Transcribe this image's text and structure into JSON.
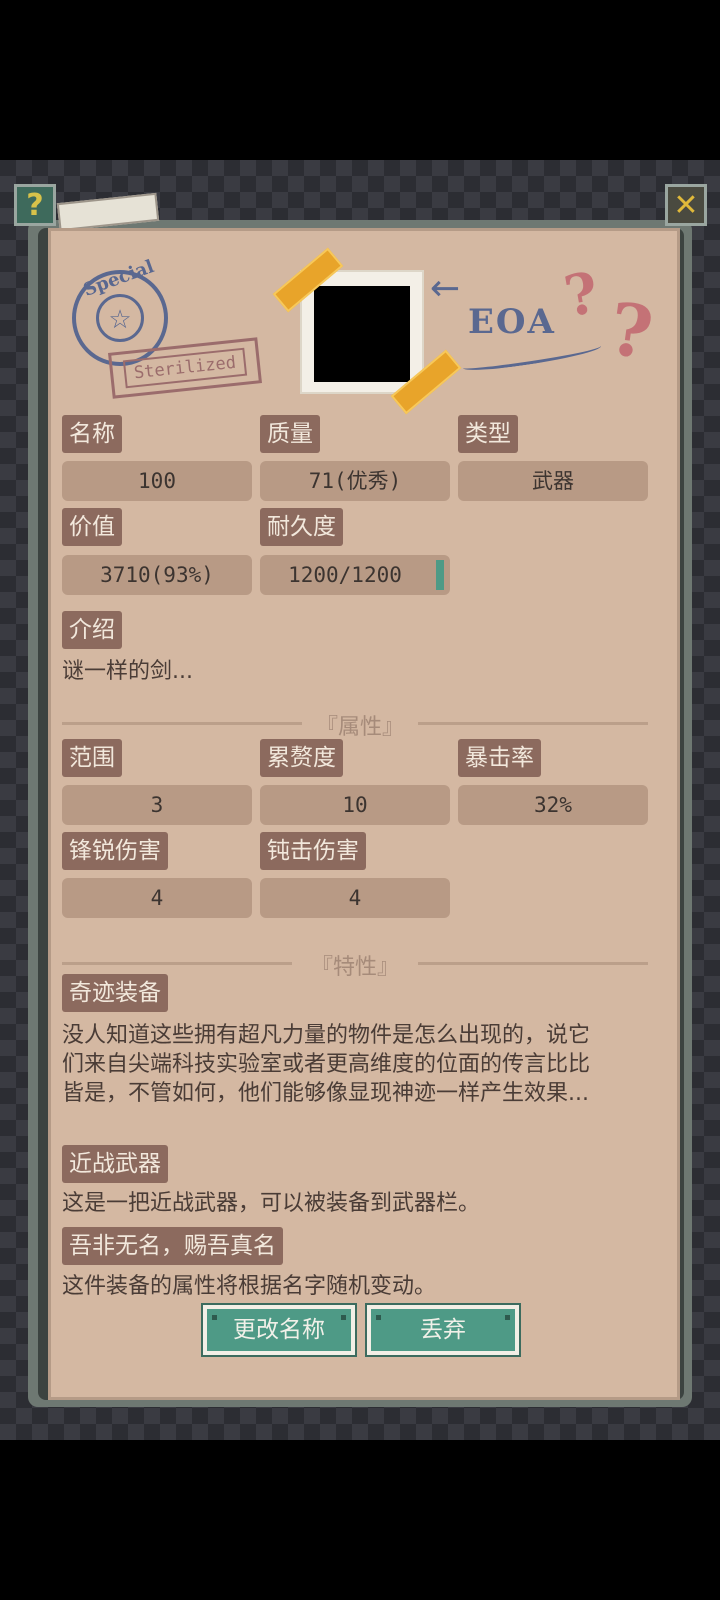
{
  "header": {
    "help_icon": "question-icon",
    "close_icon": "close-x-icon"
  },
  "decor": {
    "stamp_text": "Special",
    "steril_text": "Sterilized",
    "eoa_text": "EOA",
    "arrow": "←",
    "question_marks": [
      "?",
      "?"
    ]
  },
  "stats": {
    "name_label": "名称",
    "name_value": "100",
    "quality_label": "质量",
    "quality_value": "71(优秀)",
    "type_label": "类型",
    "type_value": "武器",
    "price_label": "价值",
    "price_value": "3710(93%)",
    "durability_label": "耐久度",
    "durability_value": "1200/1200",
    "durability_fraction": 1.0
  },
  "intro": {
    "label": "介绍",
    "text": "谜一样的剑..."
  },
  "attributes": {
    "title": "『属性』",
    "range_label": "范围",
    "range_value": "3",
    "burden_label": "累赘度",
    "burden_value": "10",
    "crit_label": "暴击率",
    "crit_value": "32%",
    "sharp_label": "锋锐伤害",
    "sharp_value": "4",
    "blunt_label": "钝击伤害",
    "blunt_value": "4"
  },
  "traits": {
    "title": "『特性』",
    "items": [
      {
        "label": "奇迹装备",
        "lines": [
          "没人知道这些拥有超凡力量的物件是怎么出现的，说它",
          "们来自尖端科技实验室或者更高维度的位面的传言比比",
          "皆是，不管如何，他们能够像显现神迹一样产生效果..."
        ]
      },
      {
        "label": "近战武器",
        "lines": [
          "这是一把近战武器，可以被装备到武器栏。"
        ]
      },
      {
        "label": "吾非无名，赐吾真名",
        "lines": [
          "这件装备的属性将根据名字随机变动。"
        ]
      }
    ]
  },
  "actions": {
    "rename": "更改名称",
    "discard": "丢弃"
  }
}
